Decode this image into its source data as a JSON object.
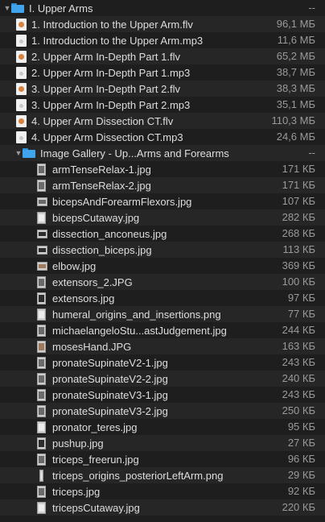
{
  "folder": {
    "name": "I. Upper Arms",
    "size": "--"
  },
  "files": [
    {
      "name": "1. Introduction to the Upper Arm.flv",
      "size": "96,1 МБ",
      "kind": "flv"
    },
    {
      "name": "1. Introduction to the Upper Arm.mp3",
      "size": "11,6 МБ",
      "kind": "mp3"
    },
    {
      "name": "2. Upper Arm In-Depth Part 1.flv",
      "size": "65,2 МБ",
      "kind": "flv"
    },
    {
      "name": "2. Upper Arm In-Depth Part 1.mp3",
      "size": "38,7 МБ",
      "kind": "mp3"
    },
    {
      "name": "3. Upper Arm In-Depth Part 2.flv",
      "size": "38,3 МБ",
      "kind": "flv"
    },
    {
      "name": "3. Upper Arm In-Depth Part 2.mp3",
      "size": "35,1 МБ",
      "kind": "mp3"
    },
    {
      "name": "4. Upper Arm Dissection CT.flv",
      "size": "110,3 МБ",
      "kind": "flv"
    },
    {
      "name": "4. Upper Arm Dissection CT.mp3",
      "size": "24,6 МБ",
      "kind": "mp3"
    }
  ],
  "subfolder": {
    "name": "Image Gallery - Up...Arms and Forearms",
    "size": "--"
  },
  "images": [
    {
      "name": "armTenseRelax-1.jpg",
      "size": "171 КБ",
      "style": ""
    },
    {
      "name": "armTenseRelax-2.jpg",
      "size": "171 КБ",
      "style": ""
    },
    {
      "name": "bicepsAndForearmFlexors.jpg",
      "size": "107 КБ",
      "style": "wide"
    },
    {
      "name": "bicepsCutaway.jpg",
      "size": "282 КБ",
      "style": "light"
    },
    {
      "name": "dissection_anconeus.jpg",
      "size": "268 КБ",
      "style": "wide dark"
    },
    {
      "name": "dissection_biceps.jpg",
      "size": "113 КБ",
      "style": "wide dark"
    },
    {
      "name": "elbow.jpg",
      "size": "369 КБ",
      "style": "wide warm"
    },
    {
      "name": "extensors_2.JPG",
      "size": "100 КБ",
      "style": ""
    },
    {
      "name": "extensors.jpg",
      "size": "97 КБ",
      "style": "dark"
    },
    {
      "name": "humeral_origins_and_insertions.png",
      "size": "77 КБ",
      "style": "light"
    },
    {
      "name": "michaelangeloStu...astJudgement.jpg",
      "size": "244 КБ",
      "style": ""
    },
    {
      "name": "mosesHand.JPG",
      "size": "163 КБ",
      "style": "warm"
    },
    {
      "name": "pronateSupinateV2-1.jpg",
      "size": "243 КБ",
      "style": ""
    },
    {
      "name": "pronateSupinateV2-2.jpg",
      "size": "240 КБ",
      "style": ""
    },
    {
      "name": "pronateSupinateV3-1.jpg",
      "size": "243 КБ",
      "style": ""
    },
    {
      "name": "pronateSupinateV3-2.jpg",
      "size": "250 КБ",
      "style": ""
    },
    {
      "name": "pronator_teres.jpg",
      "size": "95 КБ",
      "style": "light"
    },
    {
      "name": "pushup.jpg",
      "size": "27 КБ",
      "style": "dark"
    },
    {
      "name": "triceps_freerun.jpg",
      "size": "96 КБ",
      "style": ""
    },
    {
      "name": "triceps_origins_posteriorLeftArm.png",
      "size": "29 КБ",
      "style": "tall light"
    },
    {
      "name": "triceps.jpg",
      "size": "92 КБ",
      "style": ""
    },
    {
      "name": "tricepsCutaway.jpg",
      "size": "220 КБ",
      "style": "light"
    }
  ]
}
